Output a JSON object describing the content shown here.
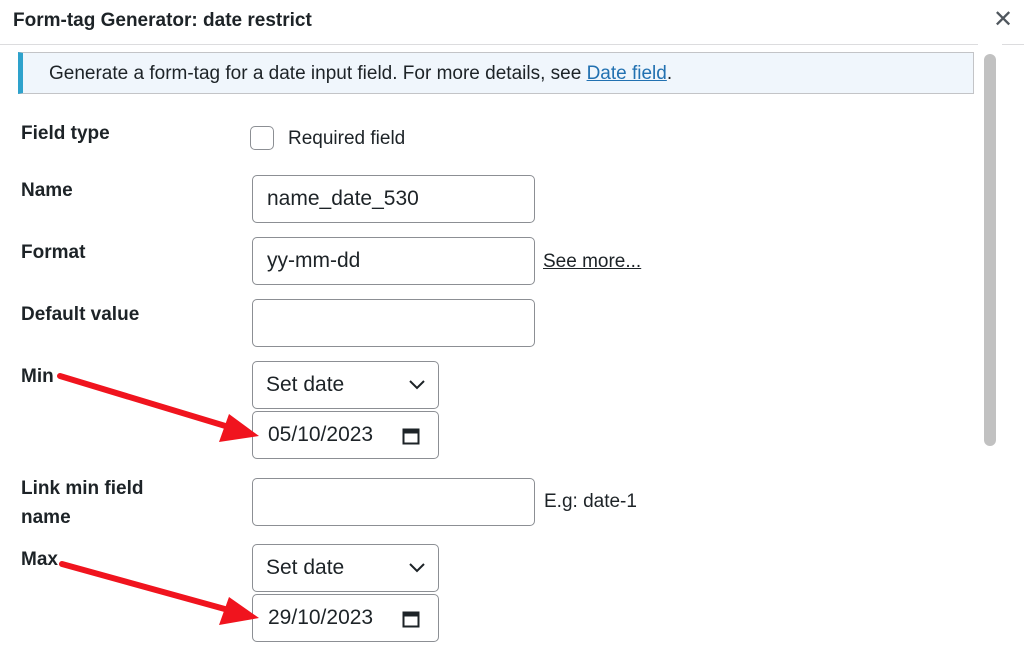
{
  "dialog": {
    "title": "Form-tag Generator: date restrict",
    "close_icon": "close-icon"
  },
  "notice": {
    "text": "Generate a form-tag for a date input field. For more details, see ",
    "link": "Date field",
    "suffix": "."
  },
  "fields": {
    "field_type": {
      "label": "Field type",
      "checkbox_label": "Required field",
      "checked": false
    },
    "name": {
      "label": "Name",
      "value": "name_date_530"
    },
    "format": {
      "label": "Format",
      "value": "yy-mm-dd",
      "link": "See more..."
    },
    "default_value": {
      "label": "Default value",
      "value": ""
    },
    "min": {
      "label": "Min",
      "select": "Set date",
      "date": "05/10/2023"
    },
    "link_min": {
      "label_line1": "Link min field",
      "label_line2": "name",
      "value": "",
      "hint": "E.g: date-1"
    },
    "max": {
      "label": "Max",
      "select": "Set date",
      "date": "29/10/2023"
    }
  },
  "annotations": {
    "arrow_color": "#f0141e"
  },
  "colors": {
    "link": "#2271b1",
    "notice_accent": "#2ea2cc"
  }
}
